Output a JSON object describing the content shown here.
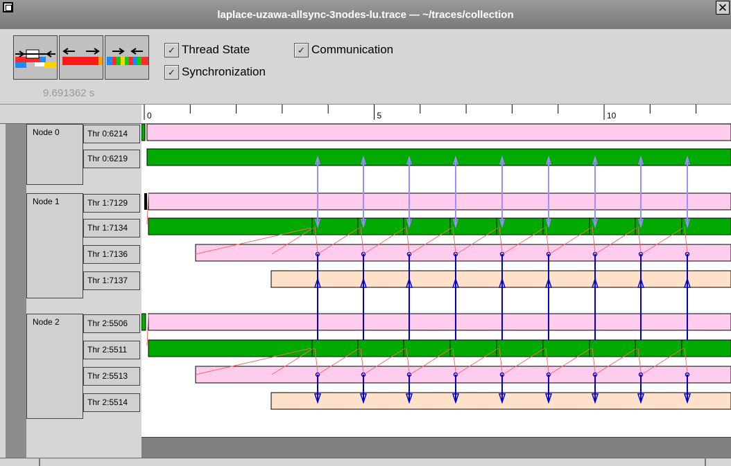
{
  "window": {
    "title": "laplace-uzawa-allsync-3nodes-lu.trace — ~/traces/collection",
    "close_glyph": "✕",
    "menu_icon": "window-menu-icon"
  },
  "toolbar": {
    "view_buttons": [
      {
        "name": "thread-state-view-icon"
      },
      {
        "name": "communication-view-icon"
      },
      {
        "name": "synchronization-view-icon"
      }
    ],
    "time_label": "9.691362 s",
    "checkboxes": {
      "thread_state": {
        "label": "Thread State",
        "checked": true
      },
      "communication": {
        "label": "Communication",
        "checked": true
      },
      "synchronization": {
        "label": "Synchronization",
        "checked": true
      }
    }
  },
  "ruler": {
    "labels": [
      {
        "value": 0,
        "text": "0"
      },
      {
        "value": 5,
        "text": "5"
      },
      {
        "value": 10,
        "text": "10"
      }
    ]
  },
  "nodes": [
    {
      "label": "Node 0",
      "threads": [
        "Thr 0:6214",
        "Thr 0:6219"
      ]
    },
    {
      "label": "Node 1",
      "threads": [
        "Thr 1:7129",
        "Thr 1:7134",
        "Thr 1:7136",
        "Thr 1:7137"
      ]
    },
    {
      "label": "Node 2",
      "threads": [
        "Thr 2:5506",
        "Thr 2:5511",
        "Thr 2:5513",
        "Thr 2:5514"
      ]
    }
  ],
  "colors": {
    "running": "#00aa00",
    "waiting": "#ffccee",
    "blocked": "#ffe0c8",
    "sync_light": "#9b8cff",
    "sync_dark": "#0000cc",
    "communication": "#ff6666"
  }
}
